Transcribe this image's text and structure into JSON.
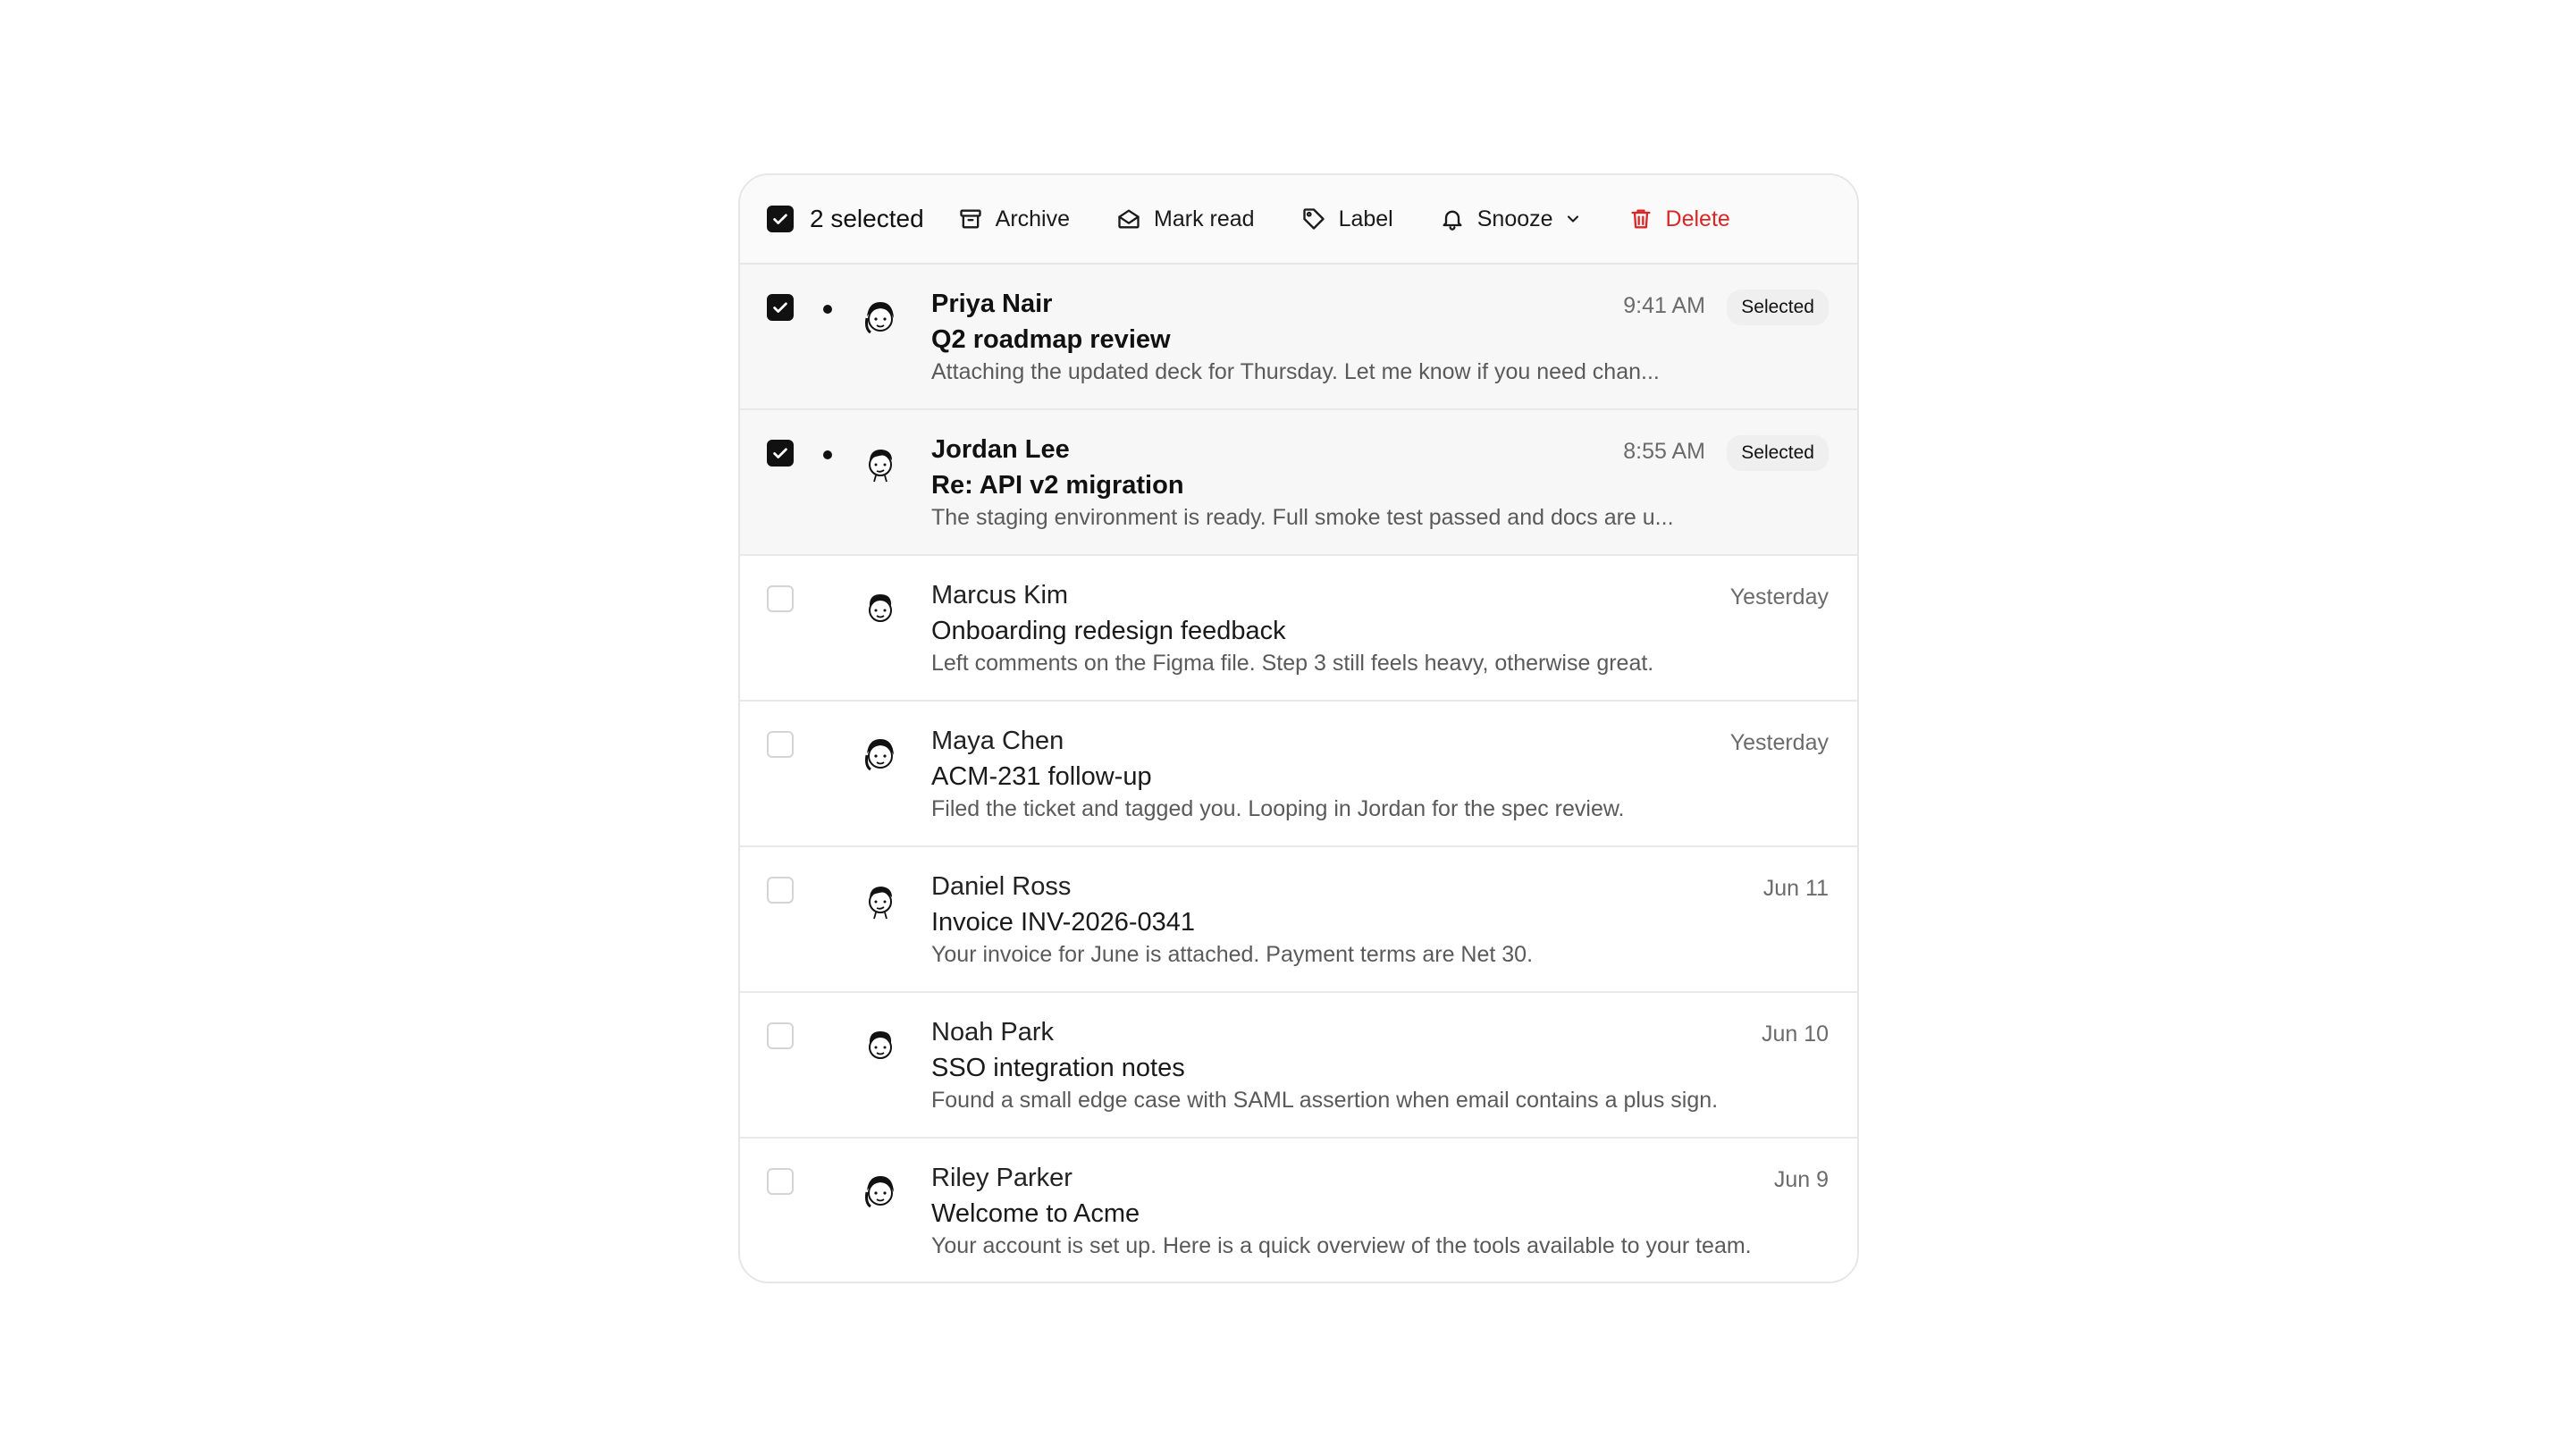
{
  "toolbar": {
    "selected_label": "2 selected",
    "archive": "Archive",
    "mark_read": "Mark read",
    "label": "Label",
    "snooze": "Snooze",
    "delete": "Delete"
  },
  "colors": {
    "danger": "#dc2626",
    "checkbox_checked": "#111111",
    "selected_row_bg": "#f7f7f7"
  },
  "messages": [
    {
      "sender": "Priya Nair",
      "subject": "Q2 roadmap review",
      "preview": "Attaching the updated deck for Thursday. Let me know if you need chan...",
      "time": "9:41 AM",
      "badge": "Selected",
      "selected": true,
      "unread": true
    },
    {
      "sender": "Jordan Lee",
      "subject": "Re: API v2 migration",
      "preview": "The staging environment is ready. Full smoke test passed and docs are u...",
      "time": "8:55 AM",
      "badge": "Selected",
      "selected": true,
      "unread": true
    },
    {
      "sender": "Marcus Kim",
      "subject": "Onboarding redesign feedback",
      "preview": "Left comments on the Figma file. Step 3 still feels heavy, otherwise great.",
      "time": "Yesterday",
      "selected": false,
      "unread": false
    },
    {
      "sender": "Maya Chen",
      "subject": "ACM-231 follow-up",
      "preview": "Filed the ticket and tagged you. Looping in Jordan for the spec review.",
      "time": "Yesterday",
      "selected": false,
      "unread": false
    },
    {
      "sender": "Daniel Ross",
      "subject": "Invoice INV-2026-0341",
      "preview": "Your invoice for June is attached. Payment terms are Net 30.",
      "time": "Jun 11",
      "selected": false,
      "unread": false
    },
    {
      "sender": "Noah Park",
      "subject": "SSO integration notes",
      "preview": "Found a small edge case with SAML assertion when email contains a plus sign.",
      "time": "Jun 10",
      "selected": false,
      "unread": false
    },
    {
      "sender": "Riley Parker",
      "subject": "Welcome to Acme",
      "preview": "Your account is set up. Here is a quick overview of the tools available to your team.",
      "time": "Jun 9",
      "selected": false,
      "unread": false
    }
  ]
}
